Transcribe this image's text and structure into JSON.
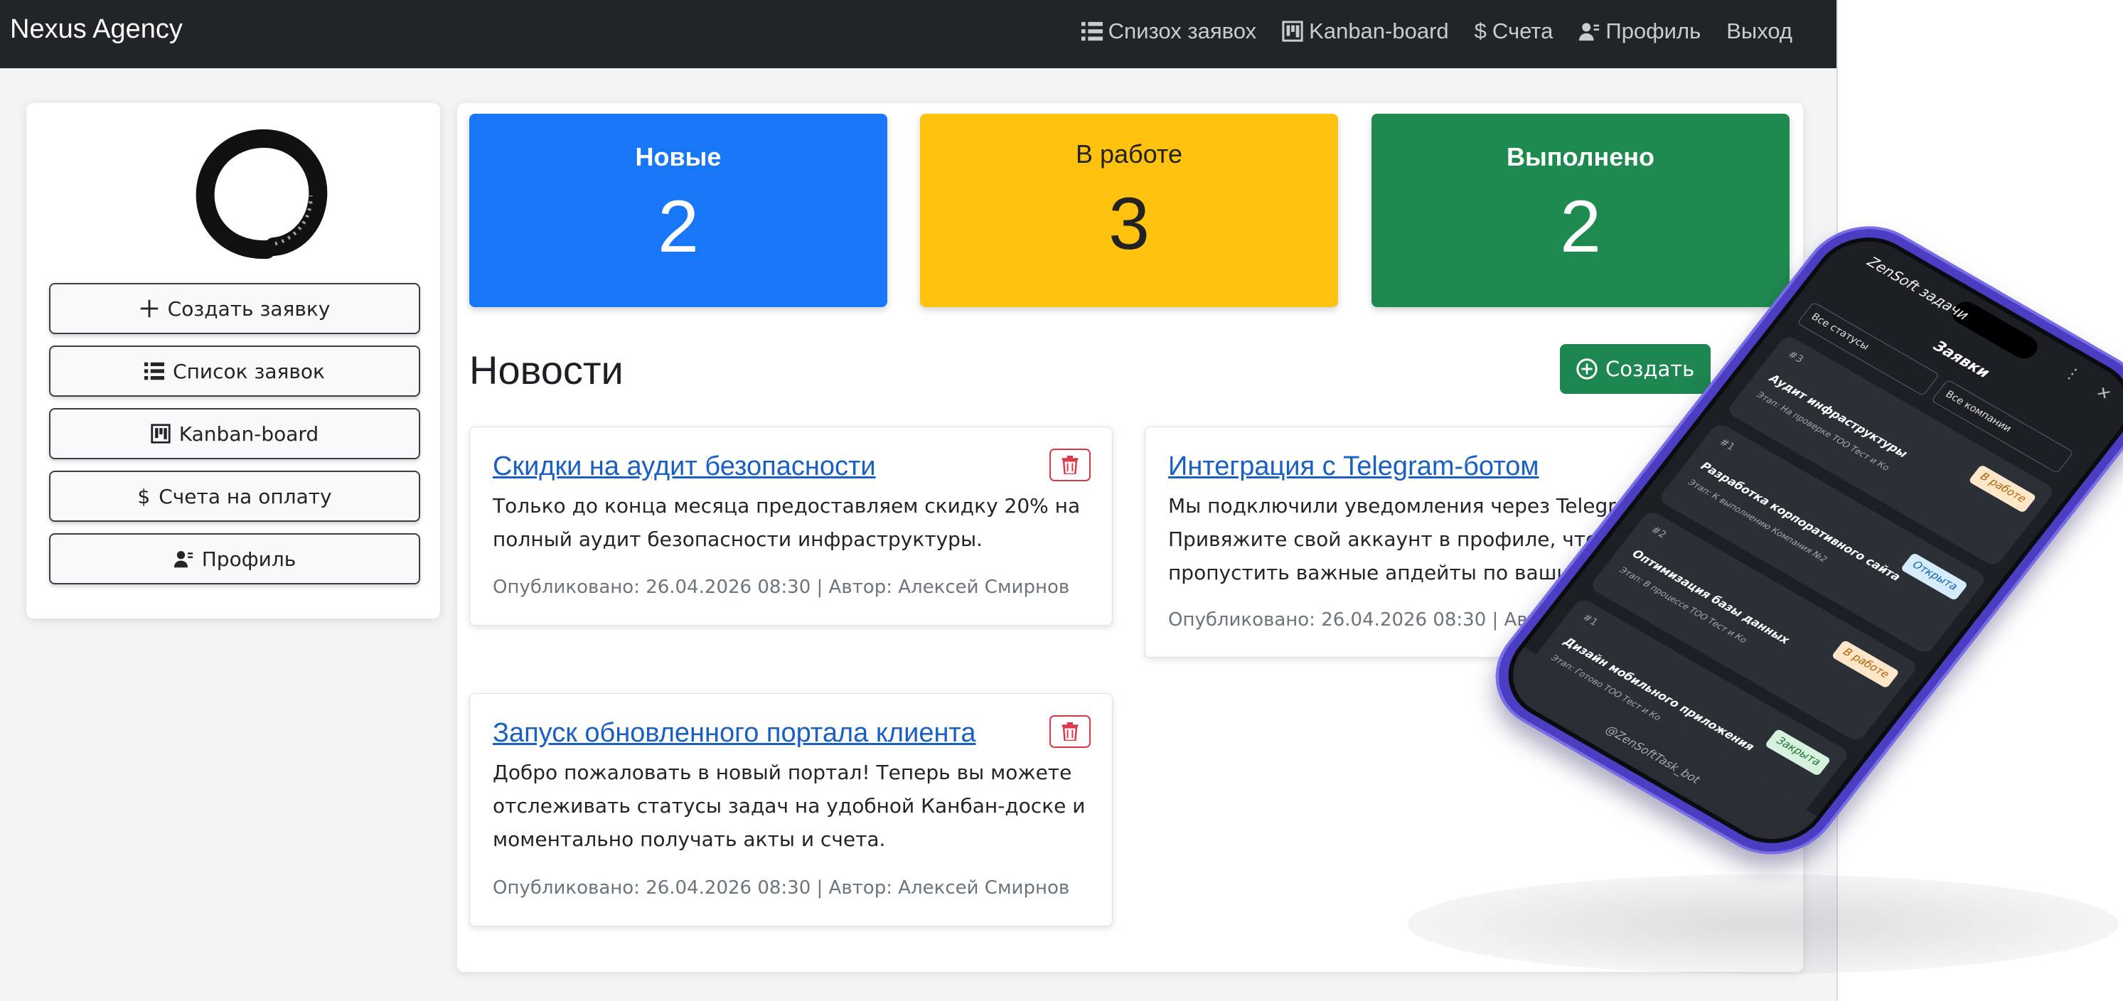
{
  "navbar": {
    "brand": "Nexus Agency",
    "links": [
      {
        "label": "Сnизох заявох",
        "icon": "list-icon"
      },
      {
        "label": "Kanban-board",
        "icon": "kanban-icon"
      },
      {
        "label": "Счета",
        "icon": "dollar-icon"
      },
      {
        "label": "Профиль",
        "icon": "user-icon"
      },
      {
        "label": "Выход",
        "icon": ""
      }
    ]
  },
  "sidebar": {
    "logo": "enso-circle-logo",
    "buttons": [
      {
        "label": "Создать заявку",
        "icon": "plus-icon"
      },
      {
        "label": "Список заявок",
        "icon": "list-icon"
      },
      {
        "label": "Kanban-board",
        "icon": "kanban-icon"
      },
      {
        "label": "Счета на оплату",
        "icon": "dollar-icon"
      },
      {
        "label": "Профиль",
        "icon": "user-icon"
      }
    ]
  },
  "stats": [
    {
      "title": "Новые",
      "value": "2",
      "color": "#1877f7"
    },
    {
      "title": "В работе",
      "value": "3",
      "color": "#ffc20e"
    },
    {
      "title": "Выполнено",
      "value": "2",
      "color": "#1f8a4f"
    }
  ],
  "news": {
    "heading": "Новости",
    "create_label": "Создать",
    "items": [
      {
        "title": "Скидки на аудит безопасности",
        "body": "Только до конца месяца предоставляем скидку 20% на полный аудит безопасности инфраструктуры.",
        "meta": "Опубликовано: 26.04.2026 08:30 | Автор: Алексей Смирнов"
      },
      {
        "title": "Интеграция с Telegram-ботом",
        "body": "Мы подключили уведомления через Telegram. Привяжите свой аккаунт в профиле, чтобы не пропустить важные апдейты по вашим задачам.",
        "meta": "Опубликовано: 26.04.2026 08:30 | Автор: Алексей Смирнов"
      },
      {
        "title": "Запуск обновленного портала клиента",
        "body": "Добро пожаловать в новый портал! Теперь вы можете отслеживать статусы задач на удобной Канбан-доске и моментально получать акты и счета.",
        "meta": "Опубликовано: 26.04.2026 08:30 | Автор: Алексей Смирнов"
      }
    ]
  },
  "phone": {
    "app_title": "ZenSoft задачи",
    "screen_title": "Заявки",
    "filters": {
      "status": "Все статусы",
      "company": "Все компании"
    },
    "tasks": [
      {
        "num": "#3",
        "name": "Аудит инфраструктуры",
        "meta": "Этап: На проверке   ТОО Тест и Ко",
        "status": "В работе",
        "badge": "work"
      },
      {
        "num": "#1",
        "name": "Разработка корпоративного сайта",
        "meta": "Этап: К выполнению   Компания №2",
        "status": "Открыта",
        "badge": "open"
      },
      {
        "num": "#2",
        "name": "Оптимизация базы данных",
        "meta": "Этап: В процессе   ТОО Тест и Ко",
        "status": "В работе",
        "badge": "work"
      },
      {
        "num": "#1",
        "name": "Дизайн мобильного приложения",
        "meta": "Этап: Готово   ТОО Тест и Ко",
        "status": "Закрыта",
        "badge": "closed"
      }
    ],
    "footer": "@ZenSoftTask_bot"
  }
}
